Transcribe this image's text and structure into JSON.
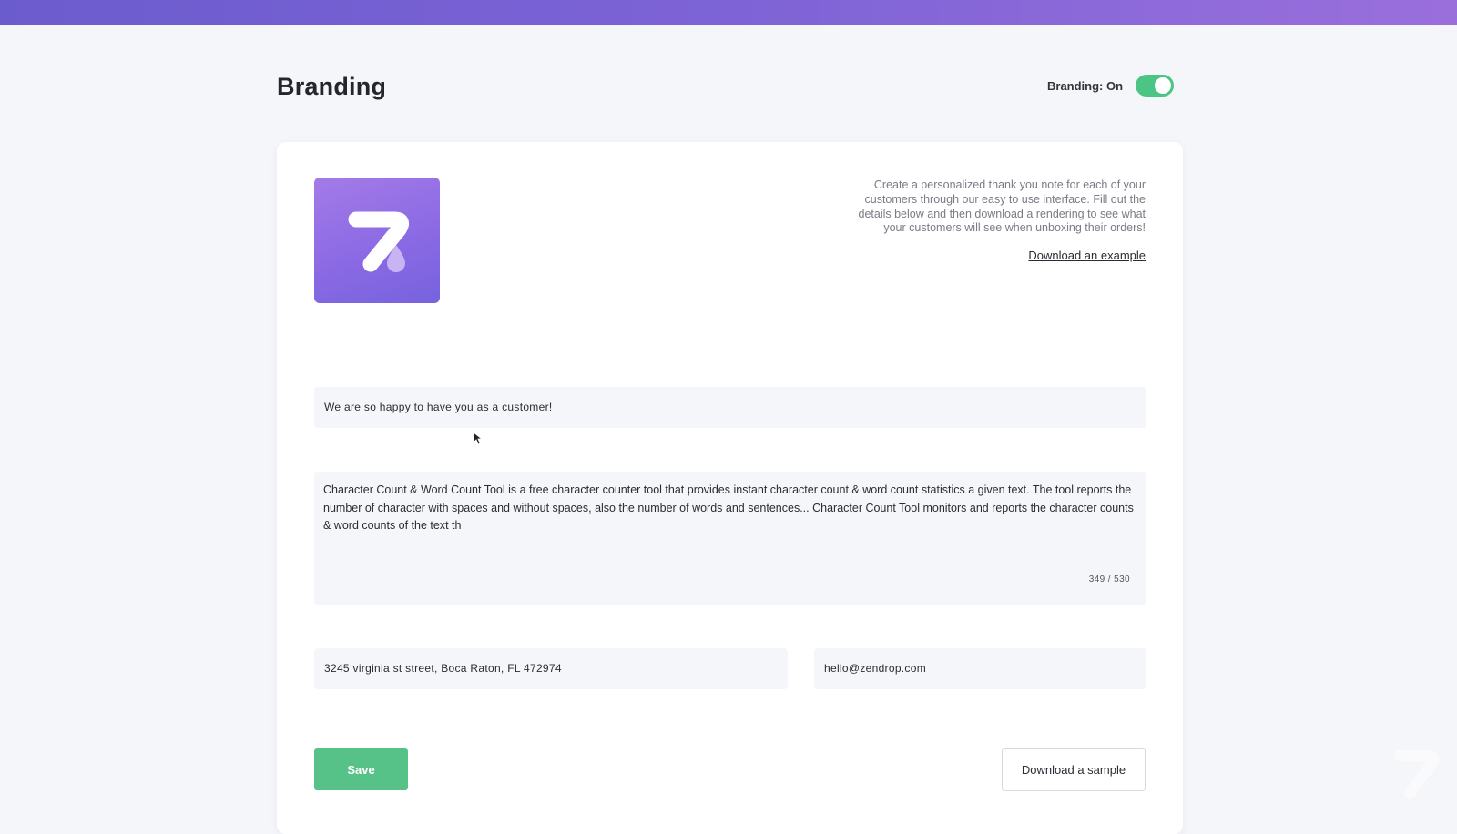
{
  "header": {
    "title": "Branding",
    "toggle_label": "Branding: On",
    "toggle_on": true
  },
  "card": {
    "logo_icon": "zendrop-logo",
    "intro_text": "Create a personalized thank you note for each of your customers through our easy to use interface. Fill out the details below and then download a rendering to see what your customers will see when unboxing their orders!",
    "download_example_label": "Download an example"
  },
  "form": {
    "headline": "We are so happy to have you as a customer!",
    "message": "Character Count & Word Count Tool is a free character counter tool that provides instant character count & word count statistics a given text. The tool reports the number of character with spaces and without spaces, also the number of words and sentences... Character Count Tool monitors and reports the character counts & word counts of the text th",
    "message_counter": "349 / 530",
    "address": "3245 virginia st street, Boca Raton, FL 472974",
    "email": "hello@zendrop.com"
  },
  "actions": {
    "save_label": "Save",
    "download_sample_label": "Download a sample"
  },
  "colors": {
    "accent_purple": "#7d63d6",
    "toggle_green": "#4cc483",
    "save_green": "#56c287"
  }
}
